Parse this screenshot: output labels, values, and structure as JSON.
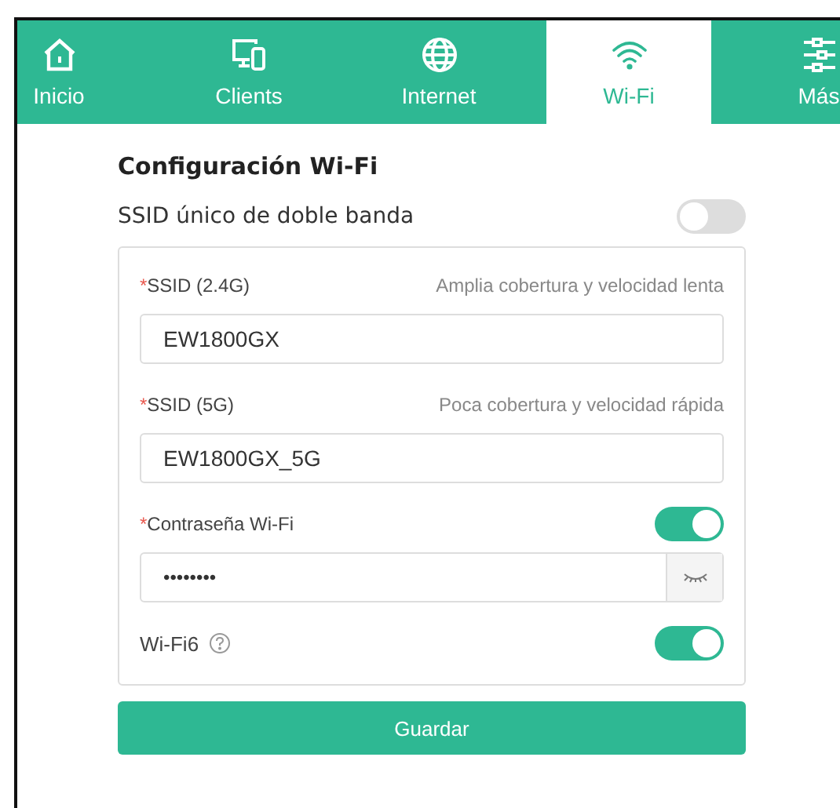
{
  "tabs": [
    {
      "label": "Inicio",
      "kind": "home",
      "selected": false
    },
    {
      "label": "Clients",
      "kind": "devices",
      "selected": false
    },
    {
      "label": "Internet",
      "kind": "globe",
      "selected": false
    },
    {
      "label": "Wi-Fi",
      "kind": "wifi",
      "selected": true
    },
    {
      "label": "Más",
      "kind": "sliders",
      "selected": false
    }
  ],
  "title": "Configuración Wi-Fi",
  "dual_band": {
    "label": "SSID único de doble banda",
    "on": false
  },
  "fields": [
    {
      "kind": "text",
      "required_mark": "*",
      "label": "SSID (2.4G)",
      "hint": "Amplia cobertura y velocidad lenta",
      "value": "EW1800GX"
    },
    {
      "kind": "text",
      "required_mark": "*",
      "label": "SSID (5G)",
      "hint": "Poca cobertura y velocidad rápida",
      "value": "EW1800GX_5G"
    },
    {
      "kind": "password",
      "required_mark": "*",
      "label": "Contraseña Wi-Fi",
      "on": true,
      "value": "••••••••"
    }
  ],
  "wifi6": {
    "label": "Wi-Fi6",
    "on": true
  },
  "save_button": "Guardar"
}
